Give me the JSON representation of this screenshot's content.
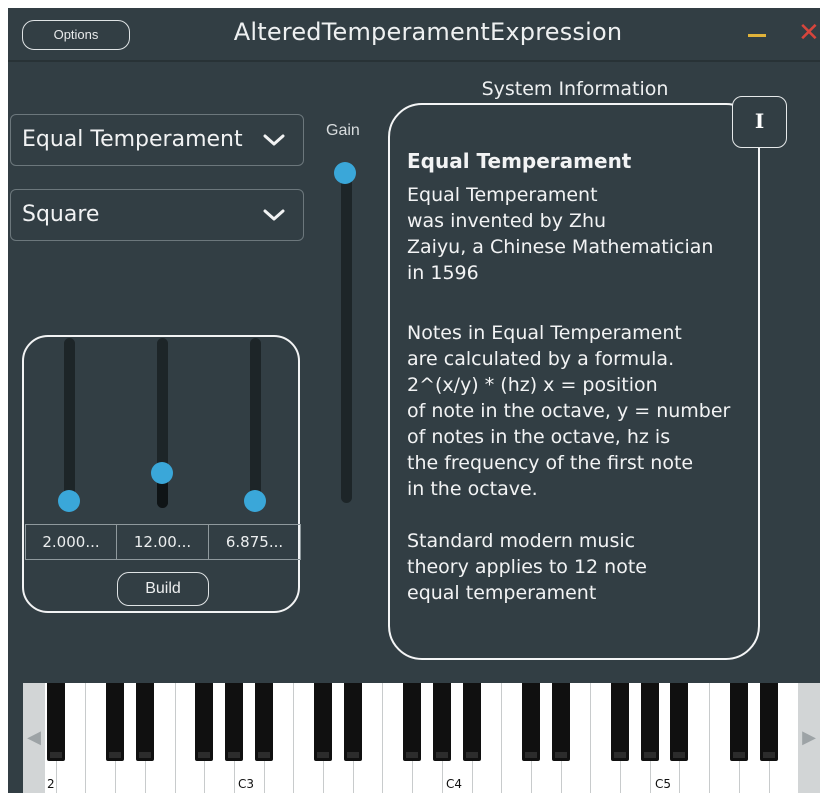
{
  "window": {
    "title": "AlteredTemperamentExpression",
    "options_label": "Options",
    "close_glyph": "✕"
  },
  "controls": {
    "temperament_value": "Equal Temperament",
    "waveform_value": "Square",
    "gain_label": "Gain",
    "gain_level": 1.0
  },
  "builder": {
    "sliders": [
      {
        "display": "2.000...",
        "level": 0.0
      },
      {
        "display": "12.00...",
        "level": 0.17
      },
      {
        "display": "6.875...",
        "level": 0.0
      }
    ],
    "build_label": "Build"
  },
  "system_info": {
    "title": "System Information",
    "info_button": "I",
    "heading": "Equal Temperament",
    "paragraph1": "Equal Temperament\nwas invented by Zhu\nZaiyu, a Chinese Mathematician\nin 1596",
    "paragraph2": "Notes in Equal Temperament\nare calculated by a formula.\n2^(x/y) * (hz) x = position\nof note in the octave, y = number\nof notes in the octave, hz is\nthe frequency of the first note\nin the octave.",
    "paragraph3": "Standard modern music\ntheory applies to 12 note\nequal temperament"
  },
  "keyboard": {
    "left_arrow": "◀",
    "right_arrow": "▶",
    "note_labels": [
      "2",
      "C3",
      "C4",
      "C5"
    ]
  },
  "colors": {
    "background": "#323e44",
    "accent": "#3aa7d9",
    "minimize": "#e0b23a",
    "close": "#d6453c"
  },
  "icons": {
    "dropdown": "chevron-down-icon",
    "minimize": "minimize-icon",
    "close": "close-icon",
    "info": "info-icon"
  }
}
